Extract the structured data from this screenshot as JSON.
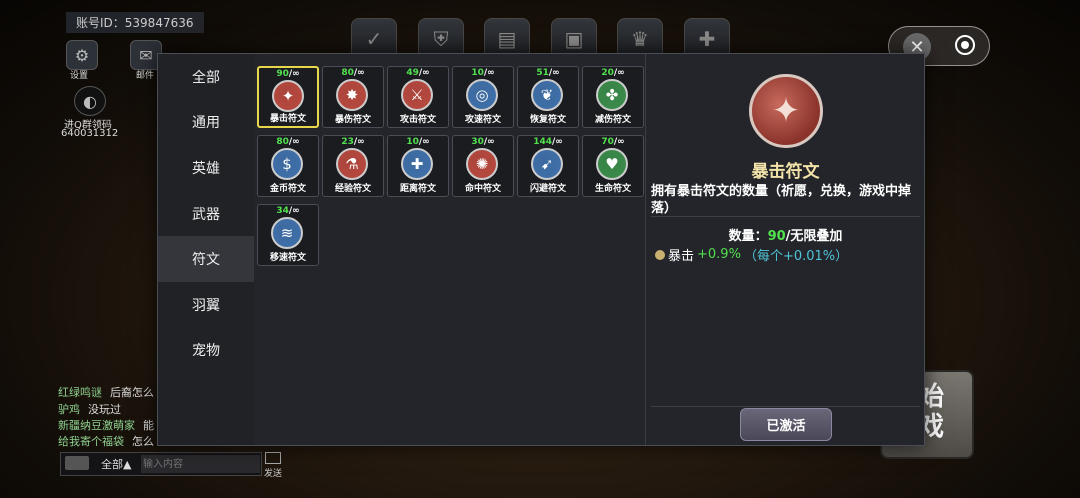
{
  "hud": {
    "account_id": "账号ID：539847636",
    "settings_label": "设置",
    "mail_label": "邮件",
    "qq_group_label": "进Q群领码",
    "qq_group_number": "640031312",
    "start_game_label": "始\n戏",
    "send_label": "发送",
    "chat_channel": "全部▲",
    "chat_placeholder": "输入内容"
  },
  "chat": [
    {
      "name": "红绿鸣谜",
      "text": "后裔怎么"
    },
    {
      "name": "驴鸡",
      "text": "没玩过"
    },
    {
      "name": "新疆纳豆激萌家",
      "text": "能"
    },
    {
      "name": "给我寄个福袋",
      "text": "怎么"
    }
  ],
  "tabs": [
    "全部",
    "通用",
    "英雄",
    "武器",
    "符文",
    "羽翼",
    "宠物"
  ],
  "active_tab": 4,
  "runes": [
    {
      "count": "90",
      "max": "/∞",
      "name": "暴击符文",
      "color": "#b5483e",
      "glyph": "✦"
    },
    {
      "count": "80",
      "max": "/∞",
      "name": "暴伤符文",
      "color": "#b5483e",
      "glyph": "✸"
    },
    {
      "count": "49",
      "max": "/∞",
      "name": "攻击符文",
      "color": "#b5483e",
      "glyph": "⚔"
    },
    {
      "count": "10",
      "max": "/∞",
      "name": "攻速符文",
      "color": "#3f6fa8",
      "glyph": "◎"
    },
    {
      "count": "51",
      "max": "/∞",
      "name": "恢复符文",
      "color": "#3f6fa8",
      "glyph": "❦"
    },
    {
      "count": "20",
      "max": "/∞",
      "name": "减伤符文",
      "color": "#3a8a4a",
      "glyph": "✤"
    },
    {
      "count": "80",
      "max": "/∞",
      "name": "金币符文",
      "color": "#3f6fa8",
      "glyph": "$"
    },
    {
      "count": "23",
      "max": "/∞",
      "name": "经验符文",
      "color": "#b5483e",
      "glyph": "⚗"
    },
    {
      "count": "10",
      "max": "/∞",
      "name": "距离符文",
      "color": "#3f6fa8",
      "glyph": "✚"
    },
    {
      "count": "30",
      "max": "/∞",
      "name": "命中符文",
      "color": "#b5483e",
      "glyph": "✺"
    },
    {
      "count": "144",
      "max": "/∞",
      "name": "闪避符文",
      "color": "#3f6fa8",
      "glyph": "➹"
    },
    {
      "count": "70",
      "max": "/∞",
      "name": "生命符文",
      "color": "#3a8a4a",
      "glyph": "♥"
    },
    {
      "count": "34",
      "max": "/∞",
      "name": "移速符文",
      "color": "#3f6fa8",
      "glyph": "≋"
    }
  ],
  "selected_rune": 0,
  "detail": {
    "title": "暴击符文",
    "description": "拥有暴击符文的数量（祈愿，兑换，游戏中掉落）",
    "qty_label": "数量：",
    "qty_value": "90",
    "qty_suffix": "/无限叠加",
    "stat_name": "暴击",
    "stat_value": "+0.9%",
    "stat_each": "（每个+0.01%）",
    "button": "已激活"
  }
}
